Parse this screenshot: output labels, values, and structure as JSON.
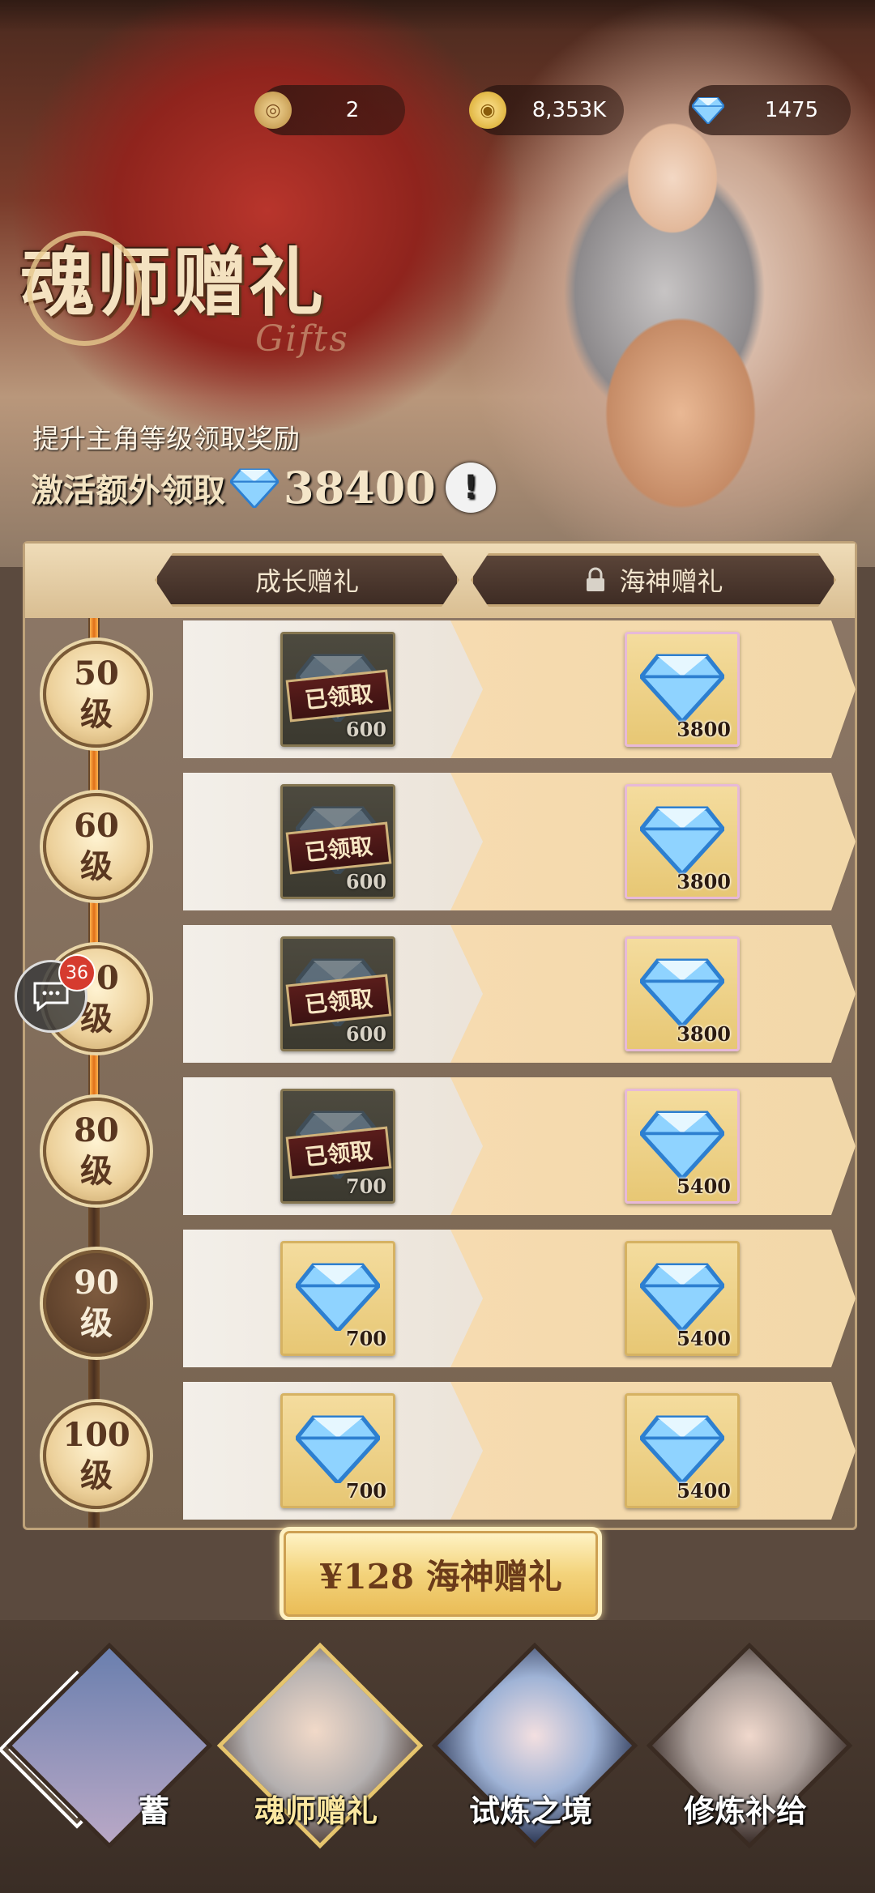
{
  "currency": {
    "tokens": "2",
    "gold": "8,353K",
    "diamonds": "1475"
  },
  "title": {
    "main": "魂师赠礼",
    "sub": "Gifts"
  },
  "promo": {
    "line1": "提升主角等级领取奖励",
    "line2_prefix": "激活额外领取",
    "line2_amount": "38400",
    "info": "!"
  },
  "tabs": {
    "growth": "成长赠礼",
    "poseidon": "海神赠礼"
  },
  "levels": [
    {
      "label": "50\n级",
      "growth_qty": "600",
      "growth_claimed": true,
      "poseidon_qty": "3800"
    },
    {
      "label": "60\n级",
      "growth_qty": "600",
      "growth_claimed": true,
      "poseidon_qty": "3800"
    },
    {
      "label": "70\n级",
      "growth_qty": "600",
      "growth_claimed": true,
      "poseidon_qty": "3800"
    },
    {
      "label": "80\n级",
      "growth_qty": "700",
      "growth_claimed": true,
      "poseidon_qty": "5400"
    },
    {
      "label": "90\n级",
      "growth_qty": "700",
      "growth_claimed": false,
      "poseidon_qty": "5400"
    },
    {
      "label": "100\n级",
      "growth_qty": "700",
      "growth_claimed": false,
      "poseidon_qty": "5400"
    }
  ],
  "claimed_label": "已领取",
  "buy_button": "¥128 海神赠礼",
  "chat_badge": "36",
  "nav": {
    "partial": "蓄",
    "items": [
      "魂师赠礼",
      "试炼之境",
      "修炼补给"
    ]
  },
  "colors": {
    "accent_gold": "#f3d37b",
    "claimed_red": "#5a1d1b",
    "badge_red": "#d63b2f"
  }
}
